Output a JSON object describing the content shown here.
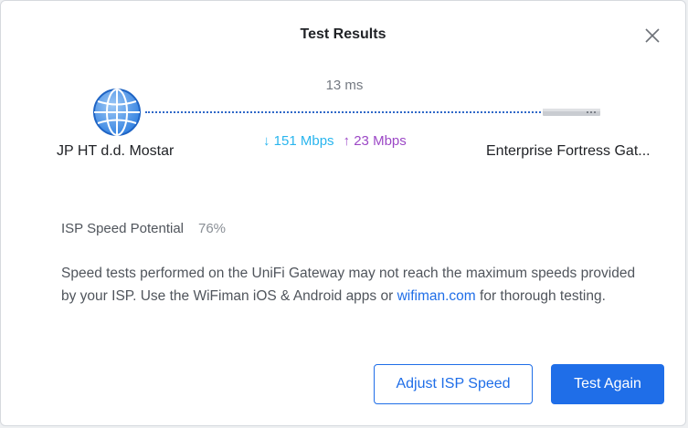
{
  "dialog": {
    "title": "Test Results",
    "close_icon": "close-icon"
  },
  "test": {
    "latency": "13 ms",
    "isp_name": "JP HT d.d. Mostar",
    "device_name": "Enterprise Fortress Gat...",
    "download_arrow": "↓",
    "download": "151 Mbps",
    "upload_arrow": "↑",
    "upload": "23 Mbps",
    "isp_icon": "globe-icon",
    "device_icon": "gateway-device-icon"
  },
  "potential": {
    "label": "ISP Speed Potential",
    "value": "76%"
  },
  "description": {
    "text_before": "Speed tests performed on the UniFi Gateway may not reach the maximum speeds provided by your ISP. Use the WiFiman iOS & Android apps or ",
    "link": "wifiman.com",
    "text_after": " for thorough testing."
  },
  "buttons": {
    "adjust": "Adjust ISP Speed",
    "test_again": "Test Again"
  },
  "colors": {
    "accent": "#1f6ee8",
    "download": "#29b5ee",
    "upload": "#9c48c6"
  }
}
